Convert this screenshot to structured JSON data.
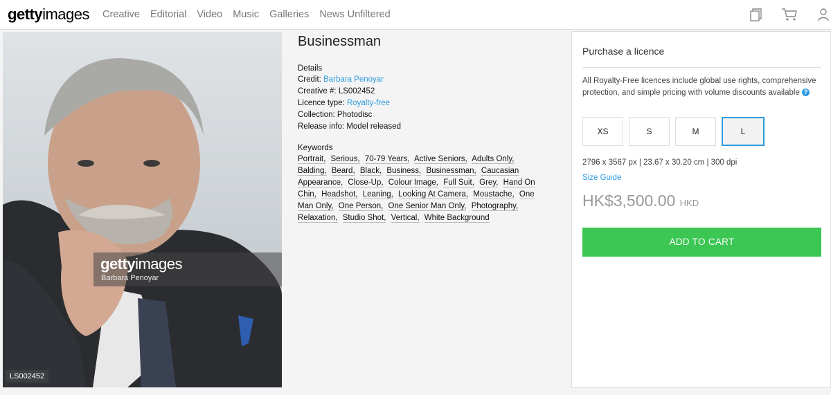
{
  "header": {
    "logo_bold": "getty",
    "logo_rest": "images",
    "nav": [
      "Creative",
      "Editorial",
      "Video",
      "Music",
      "Galleries",
      "News Unfiltered"
    ],
    "icons": [
      "boards-icon",
      "cart-icon",
      "user-icon"
    ]
  },
  "image": {
    "watermark_bold": "getty",
    "watermark_rest": "images",
    "watermark_credit": "Barbara Penoyar",
    "id_tag": "LS002452"
  },
  "details": {
    "title": "Businessman",
    "section_label": "Details",
    "credit_label": "Credit:",
    "credit_value": "Barbara Penoyar",
    "creative_label": "Creative #:",
    "creative_value": "LS002452",
    "licence_label": "Licence type:",
    "licence_value": "Royalty-free",
    "collection_label": "Collection:",
    "collection_value": "Photodisc",
    "release_label": "Release info:",
    "release_value": "Model released",
    "keywords_label": "Keywords",
    "keywords": [
      "Portrait,",
      "Serious,",
      "70-79 Years,",
      "Active Seniors,",
      "Adults Only,",
      "Balding,",
      "Beard,",
      "Black,",
      "Business,",
      "Businessman,",
      "Caucasian Appearance,",
      "Close-Up,",
      "Colour Image,",
      "Full Suit,",
      "Grey,",
      "Hand On Chin,",
      "Headshot,",
      "Leaning,",
      "Looking At Camera,",
      "Moustache,",
      "One Man Only,",
      "One Person,",
      "One Senior Man Only,",
      "Photography,",
      "Relaxation,",
      "Studio Shot,",
      "Vertical,",
      "White Background"
    ]
  },
  "purchase": {
    "title": "Purchase a licence",
    "description": "All Royalty-Free licences include global use rights, comprehensive protection, and simple pricing with volume discounts available",
    "help_glyph": "?",
    "sizes": [
      "XS",
      "S",
      "M",
      "L"
    ],
    "selected_size": "L",
    "dimensions": "2796 x 3567 px | 23.67 x 30.20 cm | 300 dpi",
    "size_guide": "Size Guide",
    "price": "HK$3,500.00",
    "currency": "HKD",
    "cta": "ADD TO CART",
    "colors": {
      "accent": "#2e9be0",
      "cta": "#3cc653"
    }
  }
}
